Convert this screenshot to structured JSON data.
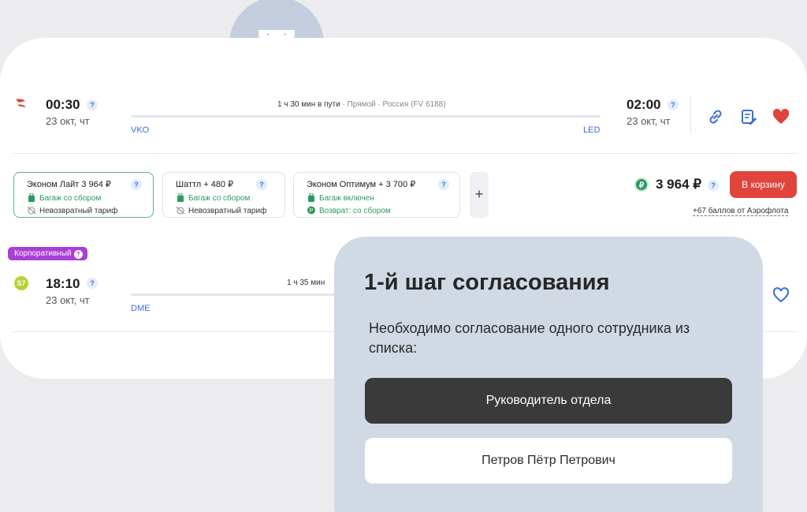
{
  "flight1": {
    "dep_time": "00:30",
    "dep_date": "23 окт, чт",
    "duration": "1 ч 30 мин в пути",
    "details": " · Прямой · Россия (FV 6188)",
    "from": "VKO",
    "to": "LED",
    "arr_time": "02:00",
    "arr_date": "23 окт, чт"
  },
  "fares": [
    {
      "name": "Эконом Лайт  3 964 ₽",
      "line1": "Багаж со сбором",
      "line2": "Невозвратный тариф"
    },
    {
      "name": "Шаттл  + 480 ₽",
      "line1": "Багаж со сбором",
      "line2": "Невозвратный тариф"
    },
    {
      "name": "Эконом Оптимум  + 3 700 ₽",
      "line1": "Багаж включен",
      "line2": "Возврат: со сбором"
    }
  ],
  "plus_label": "+",
  "price": "3 964 ₽",
  "cart_label": "В корзину",
  "bonus": "+67 баллов от Аэрофлота",
  "corp_badge": "Корпоративный",
  "flight2": {
    "dep_time": "18:10",
    "dep_date": "23 окт, чт",
    "duration": "1 ч 35 мин",
    "from": "DME"
  },
  "popup": {
    "title": "1-й шаг согласования",
    "description": "Необходимо согласование одного сотрудника из списка:",
    "option1": "Руководитель отдела",
    "option2": "Петров Пётр Петрович"
  },
  "colors": {
    "accent_red": "#e0443a",
    "link_blue": "#3a6fd6",
    "green": "#2d9a5e",
    "badge_purple": "#a93fd6",
    "popup_bg": "#d1d9e5"
  },
  "icons": [
    "ticket-icon",
    "aeroflot-logo",
    "s7-logo",
    "link-icon",
    "note-icon",
    "heart-icon",
    "heart-outline-icon",
    "luggage-icon",
    "no-refund-icon",
    "refund-icon",
    "ruble-coin-icon",
    "help-icon"
  ]
}
